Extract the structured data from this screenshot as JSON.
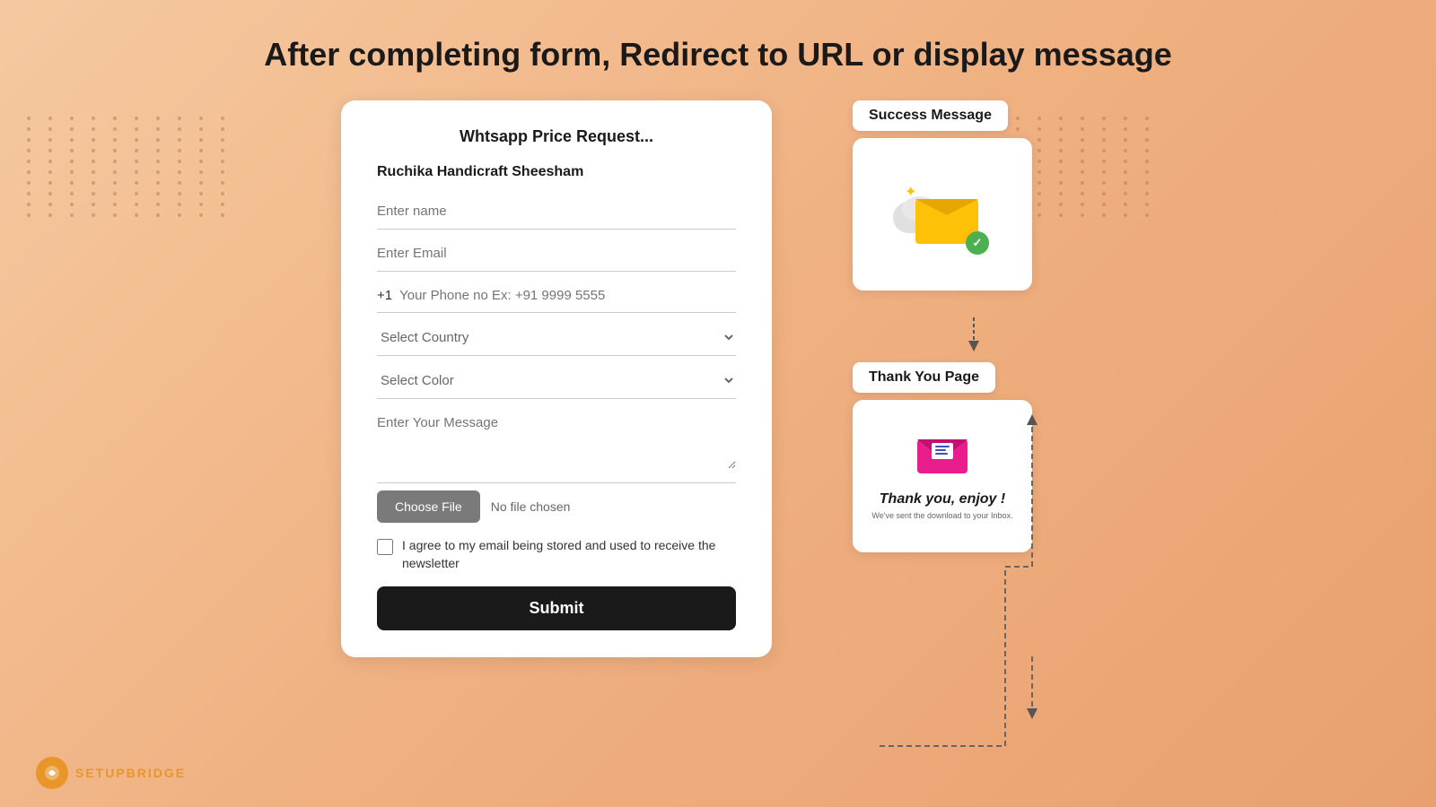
{
  "page": {
    "heading": "After completing form, Redirect to URL or display message",
    "bg_color": "#f5c2a0"
  },
  "form": {
    "title": "Whtsapp Price Request...",
    "product_name": "Ruchika Handicraft Sheesham",
    "fields": {
      "name_placeholder": "Enter name",
      "email_placeholder": "Enter Email",
      "phone_code": "+1",
      "phone_placeholder": "Your Phone no Ex: +91 9999 5555",
      "country_placeholder": "Select Country",
      "color_placeholder": "Select Color",
      "message_placeholder": "Enter Your Message"
    },
    "file": {
      "choose_label": "Choose File",
      "no_file_text": "No file chosen"
    },
    "checkbox": {
      "label": "I agree to my email being stored and used to receive the newsletter"
    },
    "submit_label": "Submit"
  },
  "flow": {
    "success_label": "Success Message",
    "thankyou_label": "Thank You Page",
    "thankyou_heading": "Thank you, enjoy !",
    "thankyou_subtext": "We've sent the download to your Inbox."
  },
  "logo": {
    "text": "SETUPBRIDGE"
  }
}
